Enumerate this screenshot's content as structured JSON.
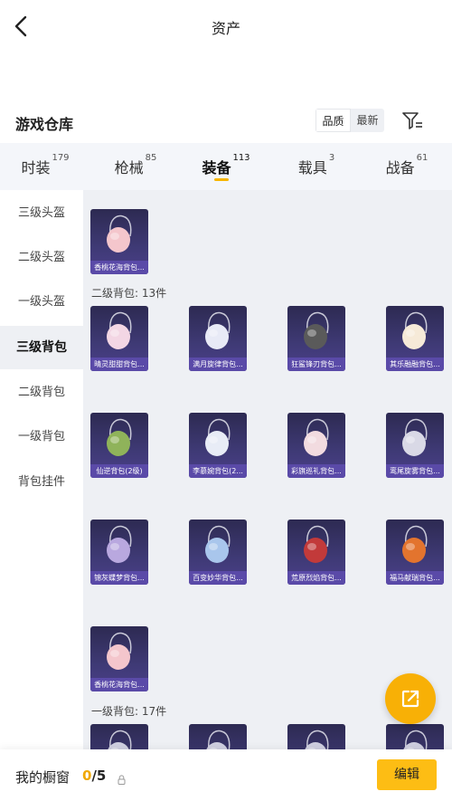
{
  "header": {
    "title": "资产"
  },
  "warehouse": {
    "title": "游戏仓库"
  },
  "sort": {
    "options": [
      "品质",
      "最新"
    ]
  },
  "tabs": [
    {
      "label": "时装",
      "count": "179"
    },
    {
      "label": "枪械",
      "count": "85"
    },
    {
      "label": "装备",
      "count": "113",
      "active": true
    },
    {
      "label": "载具",
      "count": "3"
    },
    {
      "label": "战备",
      "count": "61"
    }
  ],
  "sidebar": {
    "items": [
      "三级头盔",
      "二级头盔",
      "一级头盔",
      "三级背包",
      "二级背包",
      "一级背包",
      "背包挂件"
    ],
    "active": "三级背包"
  },
  "groups": [
    {
      "label": "二级背包: 13件"
    },
    {
      "label": "一级背包: 17件"
    }
  ],
  "items": [
    {
      "name": "香桃花海背包...",
      "color": "#f4c6cc"
    },
    {
      "name": "晴灵甜甜背包...",
      "color": "#f3d6e4"
    },
    {
      "name": "满月旋律背包...",
      "color": "#e8eaf6"
    },
    {
      "name": "狂鲨锋刃背包...",
      "color": "#5a5a5a"
    },
    {
      "name": "其乐融融背包...",
      "color": "#f6ead8"
    },
    {
      "name": "仙逆背包(2级)",
      "color": "#8fb35a"
    },
    {
      "name": "李慕婉背包(2...",
      "color": "#e8ecf6"
    },
    {
      "name": "彩旗巡礼背包...",
      "color": "#f2dbe0"
    },
    {
      "name": "鸾尾旋雾背包...",
      "color": "#d9d9e6"
    },
    {
      "name": "锦灰蝶梦背包...",
      "color": "#b9a8df"
    },
    {
      "name": "百变妙华背包...",
      "color": "#a9c6ec"
    },
    {
      "name": "荒原烈焰背包...",
      "color": "#c23a3a"
    },
    {
      "name": "福马献瑞背包...",
      "color": "#e3742e"
    },
    {
      "name": "香桃花海背包...",
      "color": "#f4c6cc"
    }
  ],
  "bottom": {
    "showcase_label": "我的橱窗",
    "showcase_current": "0",
    "showcase_total": "/5",
    "edit_label": "编辑"
  },
  "colors": {
    "accent": "#fdbd14",
    "fab": "#f8b006",
    "card_label": "#5a4aa8"
  }
}
